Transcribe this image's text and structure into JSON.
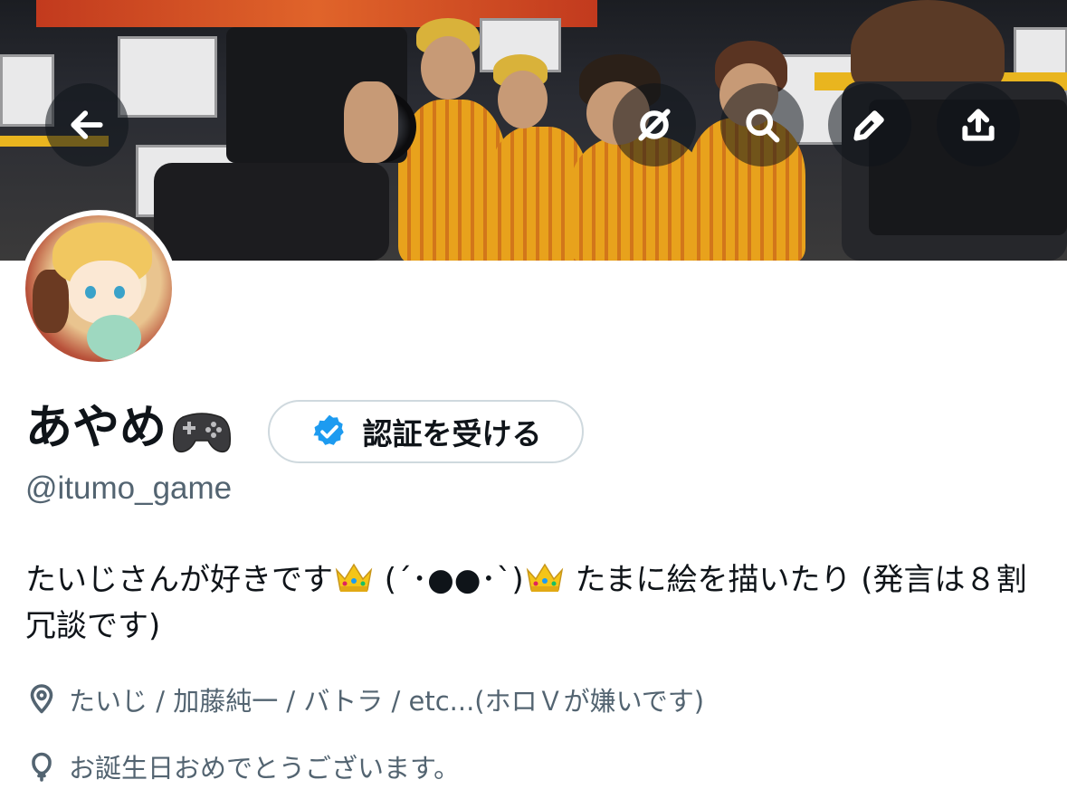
{
  "profile": {
    "display_name": "あやめ",
    "name_emoji": "gamepad-emoji",
    "handle": "@itumo_game",
    "verify_button_label": "認証を受ける",
    "bio_part1": "たいじさんが好きです",
    "bio_part2": " (´･●●･`)",
    "bio_part3": " たまに絵を描いたり (発言は８割冗談です)",
    "location": "たいじ / 加藤純一 / バトラ / etc...(ホロＶが嫌いです)",
    "birthday_note": "お誕生日おめでとうございます。"
  },
  "header_buttons": {
    "back": "back-arrow-icon",
    "unfollow": "unlink-icon",
    "search": "search-icon",
    "edit": "pencil-icon",
    "share": "share-icon"
  },
  "colors": {
    "text_primary": "#0f1419",
    "text_secondary": "#536471",
    "verified_blue": "#1d9bf0",
    "button_border": "#cfd9de"
  }
}
